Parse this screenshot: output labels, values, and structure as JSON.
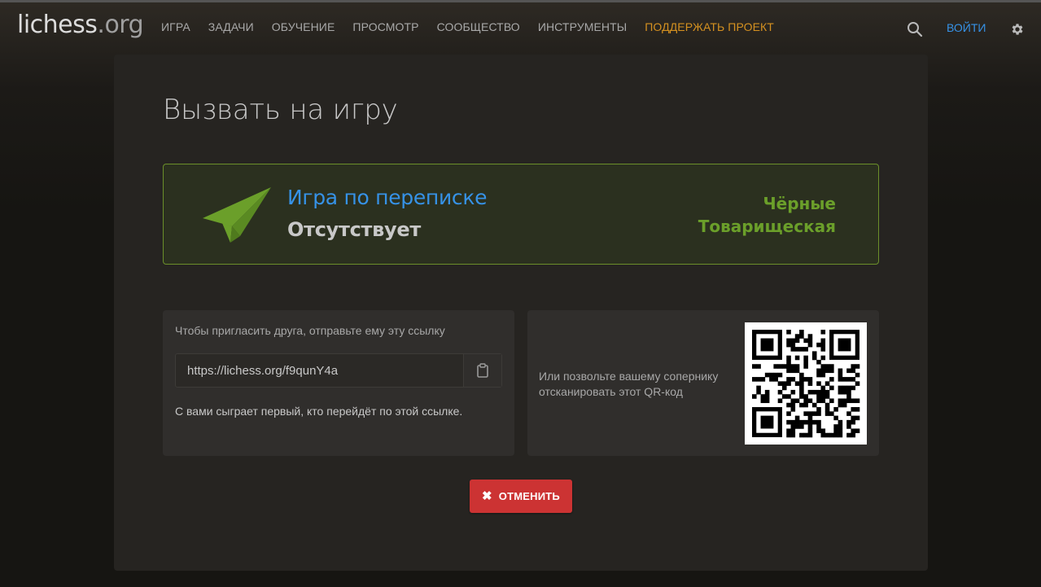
{
  "header": {
    "logo_main": "lichess",
    "logo_tld": ".org",
    "nav": [
      {
        "label": "ИГРА"
      },
      {
        "label": "ЗАДАЧИ"
      },
      {
        "label": "ОБУЧЕНИЕ"
      },
      {
        "label": "ПРОСМОТР"
      },
      {
        "label": "СООБЩЕСТВО"
      },
      {
        "label": "ИНСТРУМЕНТЫ"
      },
      {
        "label": "ПОДДЕРЖАТЬ ПРОЕКТ"
      }
    ],
    "search_icon": "search-icon",
    "signin_label": "ВОЙТИ",
    "settings_icon": "gear-icon"
  },
  "main": {
    "title": "Вызвать на игру",
    "game": {
      "icon": "paper-plane-icon",
      "title": "Игра по переписке",
      "time": "Отсутствует",
      "color": "Чёрные",
      "mode": "Товарищеская"
    },
    "invite": {
      "label": "Чтобы пригласить друга, отправьте ему эту ссылку",
      "url": "https://lichess.org/f9qunY4a",
      "copy_icon": "clipboard-icon",
      "note": "С вами сыграет первый, кто перейдёт по этой ссылке."
    },
    "qr": {
      "text": "Или позвольте вашему сопернику отсканировать этот QR-код"
    },
    "cancel_label": "ОТМЕНИТЬ"
  },
  "colors": {
    "background": "#161512",
    "card": "#262421",
    "panel": "#302e2c",
    "accent_blue": "#3692e7",
    "accent_green": "#6b9f2a",
    "donate_orange": "#d59120",
    "cancel_red": "#cc3333"
  }
}
